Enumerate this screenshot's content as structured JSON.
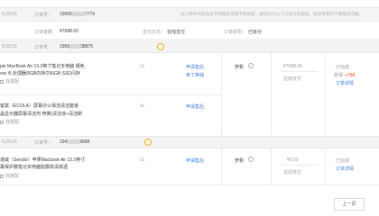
{
  "top_order": {
    "time": "5:29:23",
    "order_no_label": "订单号：",
    "order_no_prefix": "19565",
    "order_no_suffix": "7779",
    "notice": "您订单中的商品在不同库房或属不同商家，故拆分为以下订单分开配送，给您带来的不便敬请谅解。",
    "amount_label": "订单金额：",
    "amount": "¥7688.00",
    "pay_label": "支付方式：",
    "pay_value": "在线支付",
    "status_label": "订单状态：",
    "status_value": "已拆分"
  },
  "sub_order_1": {
    "time": "5:29:23",
    "order_no_label": "订单号：",
    "order_no_prefix": "1956",
    "order_no_suffix": "38875",
    "item1": {
      "title_line1": "ple MacBook Air 13.3英寸笔记本电脑 银色",
      "title_line2": "ore i5 处理器/8GB内存/256GB SSD闪存",
      "find_similar": "找搭配",
      "qty": "x1",
      "action1": "申请售后",
      "action2": "卖了换钱"
    },
    "item2": {
      "title_line1": "客案（ECOLA）屏幕办公保洁清洁套装",
      "title_line2": "晶显示器屏幕清洁剂 喷雾(清洁液+清洁刷",
      "find_similar": "找搭配",
      "qty": "x1",
      "action1": "申请售后"
    },
    "consignee": "罗帆",
    "amount": "¥7688.00",
    "pay_method": "在线支付",
    "status": "已完成",
    "points_prefix": "获得",
    "points": "+768",
    "detail_link": "订单详情"
  },
  "sub_order_2": {
    "time": "5:29:23",
    "order_no_label": "订单号：",
    "order_no_prefix": "194",
    "order_no_suffix": "9688",
    "item1": {
      "title_line1": "诺威（Sendio）苹果Macbook Air 13.3英寸",
      "title_line2": "幕保护膜笔记本电脑贴膜高清高透",
      "find_similar": "找搭配",
      "qty": "x1",
      "action1": "申请售后"
    },
    "consignee": "罗帆",
    "amount": "¥0.00",
    "pay_method": "在线支付",
    "status": "已完成",
    "detail_link": "订单详情"
  },
  "pagination": {
    "prev_label": "上一页"
  },
  "colors": {
    "accent": "#ff4400",
    "link": "#3c7bd8",
    "header_bg": "#f4f4f4"
  }
}
